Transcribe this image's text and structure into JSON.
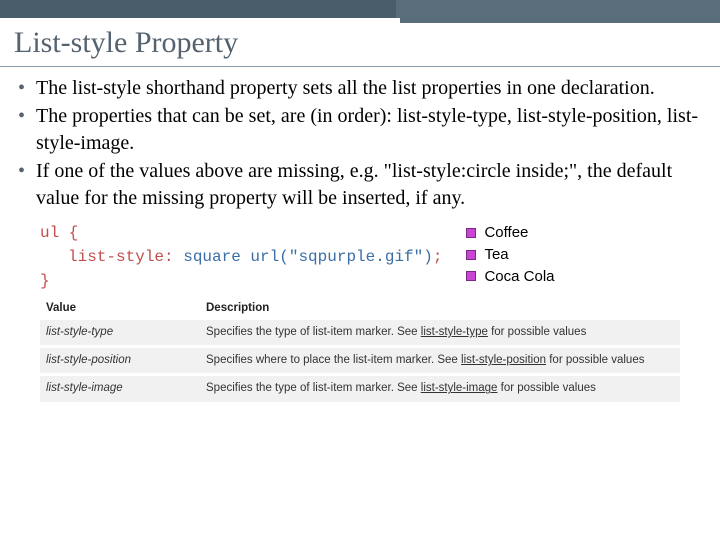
{
  "title": "List-style Property",
  "bullets": [
    "The list-style shorthand property sets all the list properties in one declaration.",
    "The properties that can be set, are (in order): list-style-type, list-style-position, list-style-image.",
    "If one of the values above are missing, e.g. \"list-style:circle inside;\", the default value for the missing property will be inserted, if any."
  ],
  "code": {
    "selector": "ul {",
    "property": "list-style",
    "value": "square url(\"sqpurple.gif\")",
    "close": "}"
  },
  "exampleList": [
    "Coffee",
    "Tea",
    "Coca Cola"
  ],
  "table": {
    "headers": {
      "value": "Value",
      "description": "Description"
    },
    "rows": [
      {
        "value": "list-style-type",
        "desc_before": "Specifies the type of list-item marker. See ",
        "link": "list-style-type",
        "desc_after": " for possible values"
      },
      {
        "value": "list-style-position",
        "desc_before": "Specifies where to place the list-item marker. See ",
        "link": "list-style-position",
        "desc_after": " for possible values"
      },
      {
        "value": "list-style-image",
        "desc_before": "Specifies the type of list-item marker. See ",
        "link": "list-style-image",
        "desc_after": " for possible values"
      }
    ]
  }
}
